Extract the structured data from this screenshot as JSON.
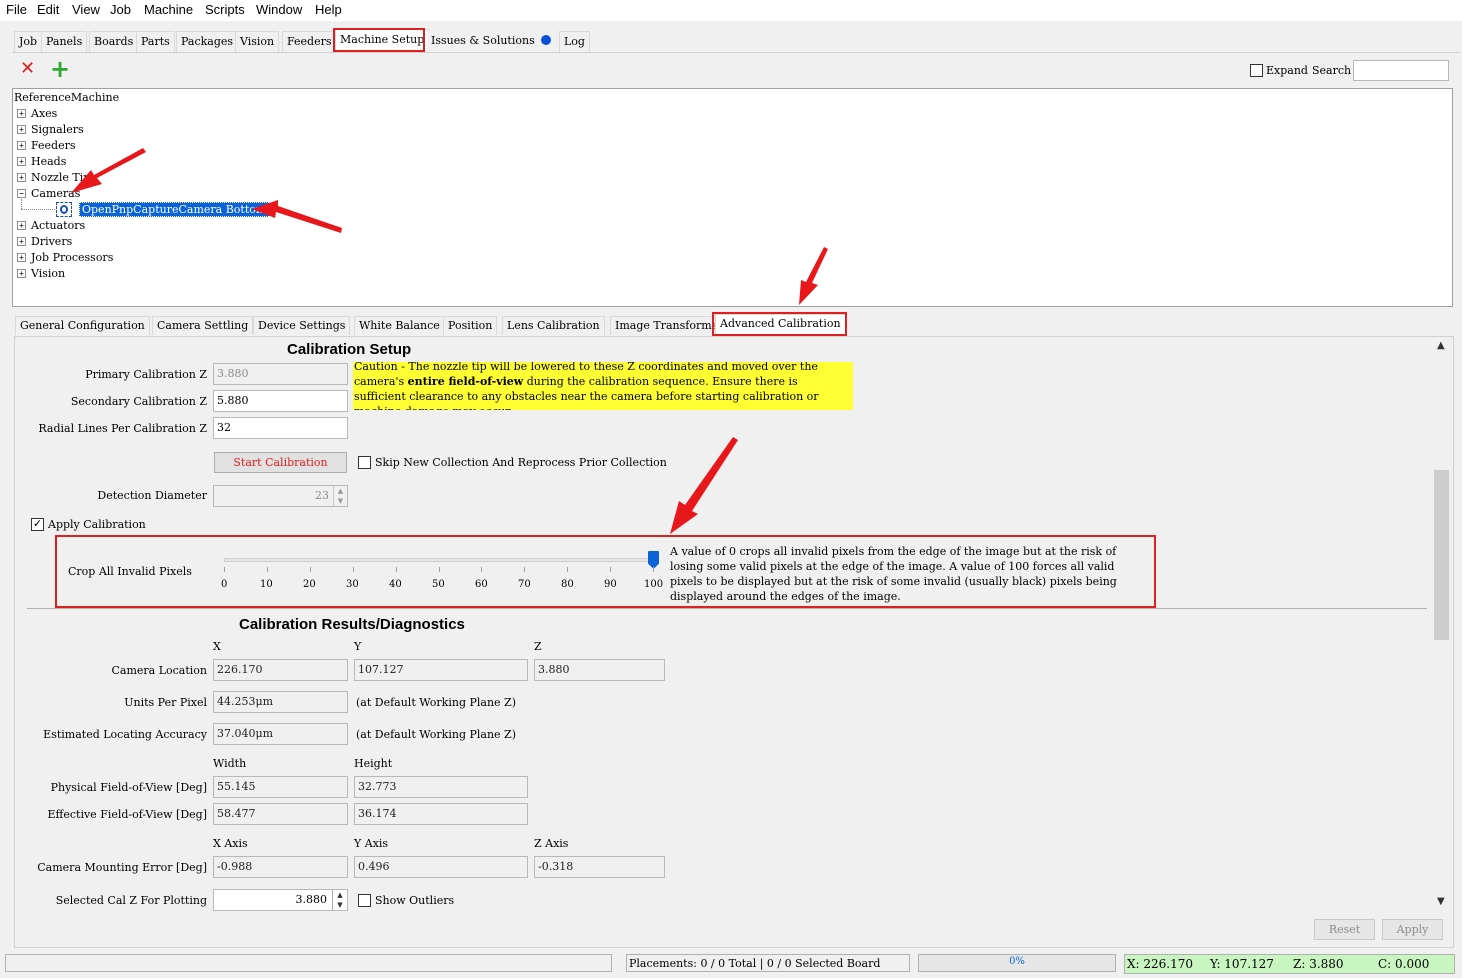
{
  "menubar": [
    "File",
    "Edit",
    "View",
    "Job",
    "Machine",
    "Scripts",
    "Window",
    "Help"
  ],
  "main_tabs": [
    "Job",
    "Panels",
    "Boards",
    "Parts",
    "Packages",
    "Vision",
    "Feeders",
    "Machine Setup",
    "Issues & Solutions",
    "Log"
  ],
  "toolbar": {
    "delete_icon": "✕",
    "add_icon": "+",
    "expand_label": "Expand",
    "search_label": "Search",
    "search_value": ""
  },
  "tree": {
    "root": "ReferenceMachine",
    "nodes": [
      "Axes",
      "Signalers",
      "Feeders",
      "Heads",
      "Nozzle Tips",
      "Cameras",
      "Actuators",
      "Drivers",
      "Job Processors",
      "Vision"
    ],
    "selected_child": "OpenPnpCaptureCamera Bottom"
  },
  "sub_tabs": [
    "General Configuration",
    "Camera Settling",
    "Device Settings",
    "White Balance",
    "Position",
    "Lens Calibration",
    "Image Transforms",
    "Advanced Calibration"
  ],
  "calibration_setup": {
    "title": "Calibration Setup",
    "primary_label": "Primary Calibration Z",
    "primary_value": "3.880",
    "secondary_label": "Secondary Calibration Z",
    "secondary_value": "5.880",
    "radial_label": "Radial Lines Per Calibration Z",
    "radial_value": "32",
    "caution_pre": "Caution - The nozzle tip will be lowered to these Z coordinates and moved over the camera's ",
    "caution_bold": "entire field-of-view",
    "caution_post": " during the calibration sequence. Ensure there is sufficient clearance to any obstacles near the camera before starting calibration or machine damage may occur.",
    "start_button": "Start Calibration",
    "skip_label": "Skip New Collection And Reprocess Prior Collection",
    "detection_label": "Detection Diameter",
    "detection_value": "23",
    "apply_label": "Apply Calibration",
    "crop_label": "Crop All Invalid Pixels",
    "crop_value": 100,
    "crop_ticks": [
      "0",
      "10",
      "20",
      "30",
      "40",
      "50",
      "60",
      "70",
      "80",
      "90",
      "100"
    ],
    "crop_help": "A value of 0 crops all invalid pixels from the edge of the image but at the risk of losing some valid pixels at the edge of the image. A value of 100 forces all valid pixels to be displayed but at the risk of some invalid (usually black) pixels being displayed around the edges of the image."
  },
  "results": {
    "title": "Calibration Results/Diagnostics",
    "col_x": "X",
    "col_y": "Y",
    "col_z": "Z",
    "camera_location_label": "Camera Location",
    "camera_location": [
      "226.170",
      "107.127",
      "3.880"
    ],
    "units_per_pixel_label": "Units Per Pixel",
    "units_per_pixel": "44.253μm",
    "at_default_1": "(at Default Working Plane Z)",
    "accuracy_label": "Estimated Locating Accuracy",
    "accuracy": "37.040μm",
    "at_default_2": "(at Default Working Plane Z)",
    "width_label": "Width",
    "height_label": "Height",
    "physical_fov_label": "Physical Field-of-View [Deg]",
    "physical_fov": [
      "55.145",
      "32.773"
    ],
    "effective_fov_label": "Effective Field-of-View [Deg]",
    "effective_fov": [
      "58.477",
      "36.174"
    ],
    "x_axis_label": "X Axis",
    "y_axis_label": "Y Axis",
    "z_axis_label": "Z Axis",
    "mounting_error_label": "Camera Mounting Error [Deg]",
    "mounting_error": [
      "-0.988",
      "0.496",
      "-0.318"
    ],
    "selected_cal_label": "Selected Cal Z For Plotting",
    "selected_cal_value": "3.880",
    "show_outliers_label": "Show Outliers"
  },
  "buttons": {
    "reset": "Reset",
    "apply": "Apply"
  },
  "status": {
    "placements": "Placements: 0 / 0 Total | 0 / 0 Selected Board",
    "progress": "0%",
    "progress_fraction": 0,
    "x": "X: 226.170",
    "y": "Y: 107.127",
    "z": "Z: 3.880",
    "c": "C: 0.000"
  },
  "colors": {
    "highlight_red": "#e02020",
    "caution_yellow": "#ffff33",
    "selection_blue": "#0a64d8",
    "dro_green": "#c8f5c0"
  }
}
